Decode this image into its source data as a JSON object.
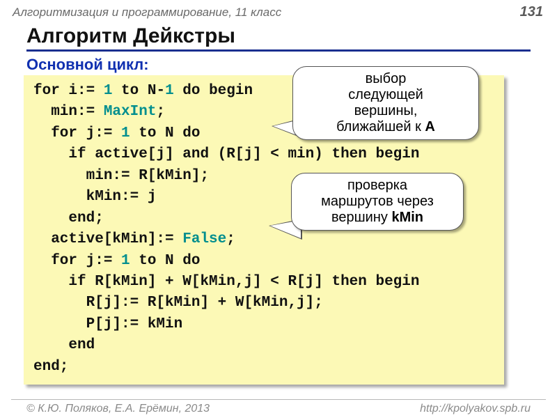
{
  "header": {
    "course": "Алгоритмизация и программирование, 11 класс",
    "page": "131"
  },
  "title": "Алгоритм Дейкстры",
  "subtitle": "Основной цикл:",
  "code_tokens": [
    [
      [
        "kw0",
        "for i:= "
      ],
      [
        "num",
        "1"
      ],
      [
        "kw0",
        " to N-"
      ],
      [
        "num",
        "1"
      ],
      [
        "kw0",
        " do begin"
      ]
    ],
    [
      [
        "kw0",
        "  min:= "
      ],
      [
        "kw",
        "MaxInt"
      ],
      [
        "kw0",
        ";"
      ]
    ],
    [
      [
        "kw0",
        "  for j:= "
      ],
      [
        "num",
        "1"
      ],
      [
        "kw0",
        " to N do"
      ]
    ],
    [
      [
        "kw0",
        "    if active[j] and (R[j] < min) then begin"
      ]
    ],
    [
      [
        "kw0",
        "      min:= R[kMin];"
      ]
    ],
    [
      [
        "kw0",
        "      kMin:= j"
      ]
    ],
    [
      [
        "kw0",
        "    end;"
      ]
    ],
    [
      [
        "kw0",
        "  active[kMin]:= "
      ],
      [
        "kw",
        "False"
      ],
      [
        "kw0",
        ";"
      ]
    ],
    [
      [
        "kw0",
        "  for j:= "
      ],
      [
        "num",
        "1"
      ],
      [
        "kw0",
        " to N do"
      ]
    ],
    [
      [
        "kw0",
        "    if R[kMin] + W[kMin,j] < R[j] then begin"
      ]
    ],
    [
      [
        "kw0",
        "      R[j]:= R[kMin] + W[kMin,j];"
      ]
    ],
    [
      [
        "kw0",
        "      P[j]:= kMin"
      ]
    ],
    [
      [
        "kw0",
        "    end"
      ]
    ],
    [
      [
        "kw0",
        "end;"
      ]
    ]
  ],
  "callouts": {
    "c1_line1": "выбор",
    "c1_line2": "следующей",
    "c1_line3": "вершины,",
    "c1_line4_pre": "ближайшей к ",
    "c1_line4_b": "A",
    "c2_line1": "проверка",
    "c2_line2": "маршрутов через",
    "c2_line3_pre": "вершину ",
    "c2_line3_b": "kMin"
  },
  "footer": {
    "left": "© К.Ю. Поляков, Е.А. Ерёмин, 2013",
    "right": "http://kpolyakov.spb.ru"
  }
}
